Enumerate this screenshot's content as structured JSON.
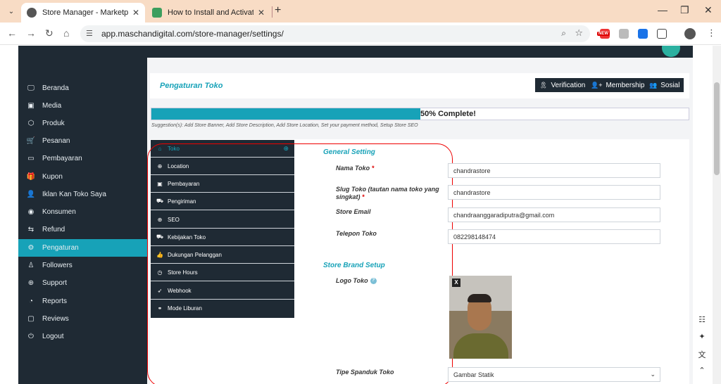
{
  "browser": {
    "tabs": [
      {
        "title": "Store Manager - Marketplace M",
        "active": true
      },
      {
        "title": "How to Install and Activate Bett",
        "active": false
      }
    ],
    "url": "app.maschandigital.com/store-manager/settings/",
    "ext_new_badge": "NEW",
    "icons": [
      "tab-list-icon",
      "close-icon",
      "new-tab-icon",
      "minimize-icon",
      "restore-icon",
      "back-icon",
      "forward-icon",
      "reload-icon",
      "home-icon",
      "site-settings-icon",
      "zoom-icon",
      "bookmark-star-icon",
      "kebab-menu-icon"
    ]
  },
  "sidebar": {
    "items": [
      {
        "label": "Beranda",
        "icon": "🖵",
        "active": false
      },
      {
        "label": "Media",
        "icon": "▣",
        "active": false
      },
      {
        "label": "Produk",
        "icon": "⬡",
        "active": false
      },
      {
        "label": "Pesanan",
        "icon": "🛒",
        "active": false
      },
      {
        "label": "Pembayaran",
        "icon": "▭",
        "active": false
      },
      {
        "label": "Kupon",
        "icon": "🎁",
        "active": false
      },
      {
        "label": "Iklan Kan Toko Saya",
        "icon": "👤",
        "active": false
      },
      {
        "label": "Konsumen",
        "icon": "◉",
        "active": false
      },
      {
        "label": "Refund",
        "icon": "⇆",
        "active": false
      },
      {
        "label": "Pengaturan",
        "icon": "⚙",
        "active": true
      },
      {
        "label": "Followers",
        "icon": "♙",
        "active": false
      },
      {
        "label": "Support",
        "icon": "⊕",
        "active": false
      },
      {
        "label": "Reports",
        "icon": "◔",
        "active": false
      },
      {
        "label": "Reviews",
        "icon": "▢",
        "active": false
      },
      {
        "label": "Logout",
        "icon": "⏻",
        "active": false
      }
    ]
  },
  "header": {
    "title": "Pengaturan Toko",
    "buttons": [
      {
        "label": "Verification",
        "icon": "🎗"
      },
      {
        "label": "Membership",
        "icon": "👤+"
      },
      {
        "label": "Sosial",
        "icon": "👥"
      }
    ]
  },
  "progress": {
    "percent": 50,
    "text": "50% Complete!",
    "suggestion": "Suggestion(s): Add Store Banner, Add Store Description, Add Store Location, Set your payment method, Setup Store SEO"
  },
  "settings_menu": {
    "items": [
      {
        "label": "Toko",
        "icon": "⌂",
        "active": true
      },
      {
        "label": "Location",
        "icon": "⊕",
        "active": false
      },
      {
        "label": "Pembayaran",
        "icon": "▣",
        "active": false
      },
      {
        "label": "Pengiriman",
        "icon": "⛟",
        "active": false
      },
      {
        "label": "SEO",
        "icon": "⊕",
        "active": false
      },
      {
        "label": "Kebijakan Toko",
        "icon": "⛟",
        "active": false
      },
      {
        "label": "Dukungan Pelanggan",
        "icon": "👍",
        "active": false
      },
      {
        "label": "Store Hours",
        "icon": "◷",
        "active": false
      },
      {
        "label": "Webhook",
        "icon": "➶",
        "active": false
      },
      {
        "label": "Mode Liburan",
        "icon": "⚭",
        "active": false
      }
    ]
  },
  "form": {
    "general_title": "General Setting",
    "fields": [
      {
        "label": "Nama Toko",
        "required": "*",
        "value": "chandrastore"
      },
      {
        "label": "Slug Toko (tautan nama toko yang singkat)",
        "required": "*",
        "value": "chandrastore"
      },
      {
        "label": "Store Email",
        "required": "",
        "value": "chandraanggaradiputra@gmail.com"
      },
      {
        "label": "Telepon Toko",
        "required": "",
        "value": "082298148474"
      }
    ],
    "brand_title": "Store Brand Setup",
    "logo_label": "Logo Toko",
    "logo_help": "?",
    "logo_remove": "X",
    "banner_type_label": "Tipe Spanduk Toko",
    "banner_type_value": "Gambar Statik"
  },
  "colors": {
    "accent": "#17a2b8",
    "sidebar_bg": "#1f2a34",
    "highlight_circle": "#e00000",
    "tab_strip": "#f8dcc5"
  }
}
